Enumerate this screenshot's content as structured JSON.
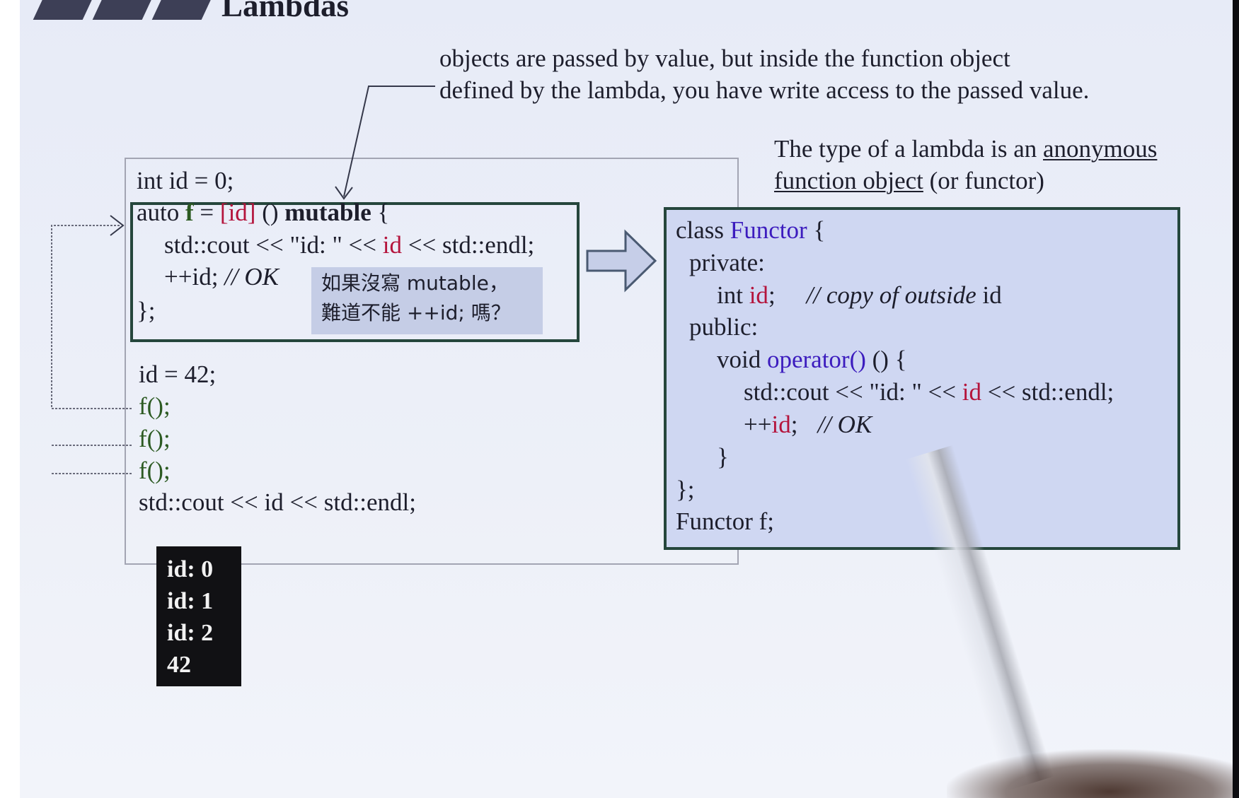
{
  "slide": {
    "title": "Lambdas",
    "note_top": {
      "line1": "objects are passed by value, but inside the function object",
      "line2": "defined by the lambda, you have write access to the passed value."
    },
    "note_type": {
      "line1_prefix": "The type of a lambda is an ",
      "line1_underlined": "anonymous",
      "line2_underlined": "function object",
      "line2_suffix": " (or functor)"
    },
    "code": {
      "line1": "int id = 0;",
      "lambda_auto": "auto ",
      "lambda_f": "f",
      "lambda_eq": " = ",
      "lambda_capture": "[id]",
      "lambda_params": " () ",
      "lambda_mutable": "mutable",
      "lambda_brace": " {",
      "body1_a": "std::cout << \"id: \" << ",
      "body1_id": "id",
      "body1_b": " << std::endl;",
      "body2_incr": "++id; ",
      "body2_comment": "// OK",
      "close": "};",
      "assign": "id = 42;",
      "call1": "f();",
      "call2": "f();",
      "call3": "f();",
      "print": "std::cout << id << std::endl;"
    },
    "callout_zh": {
      "line1": "如果沒寫 mutable，",
      "line2": "難道不能 ++id; 嗎？"
    },
    "output": [
      "id: 0",
      "id: 1",
      "id: 2",
      "42"
    ],
    "functor": {
      "l1_class": "class ",
      "l1_name": "Functor",
      "l1_brace": " {",
      "l2": "private:",
      "l3_type": "int ",
      "l3_id": "id",
      "l3_semi": ";",
      "l3_comment": "// copy of outside",
      "l3_tail": " id",
      "l4": "public:",
      "l5_void": "void ",
      "l5_op": "operator()",
      "l5_rest": " () {",
      "l6_a": "std::cout << \"id: \" << ",
      "l6_id": "id",
      "l6_b": " << std::endl;",
      "l7_incr": "++",
      "l7_id": "id",
      "l7_semi": ";",
      "l7_comment": "// OK",
      "l8": "}",
      "l9": "};",
      "l10": "Functor f;"
    },
    "colors": {
      "slide_bg": "#e9edf8",
      "box_border": "#25463c",
      "identifier_red": "#b4143c",
      "type_blue": "#3c1cbe",
      "callout_bg": "#c5cde6",
      "functor_bg": "#cfd7f2",
      "output_bg": "#111114"
    },
    "icons": [
      "right-arrow-icon",
      "laser-pointer"
    ]
  }
}
